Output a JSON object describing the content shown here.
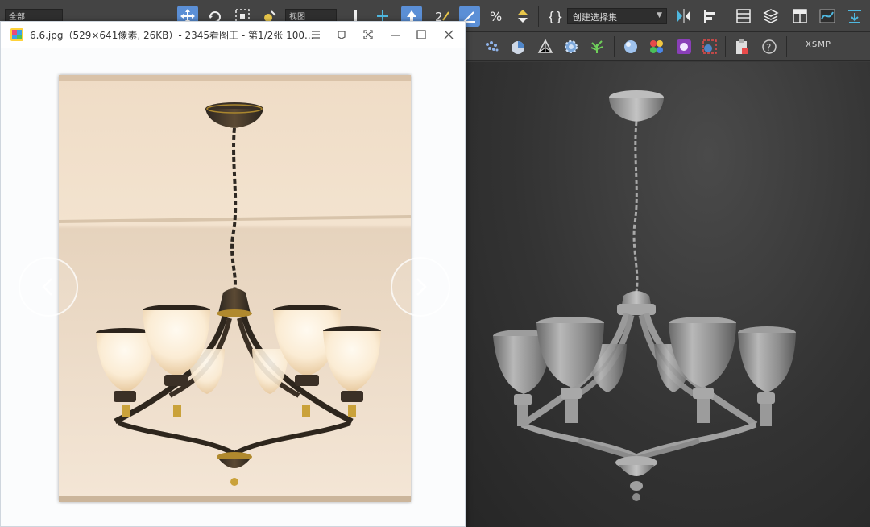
{
  "max": {
    "selection_filter": "全部",
    "view_dropdown": "视图",
    "named_selection": "创建选择集",
    "renderer_label": "XSMP",
    "colors": {
      "toolbar_bg": "#444444",
      "active_btn": "#5b8fd6",
      "viewport_bg": "#333333"
    }
  },
  "viewer": {
    "title": "6.6.jpg（529×641像素, 26KB）- 2345看图王 - 第1/2张 100...",
    "icons": [
      "menu-icon",
      "pin-icon",
      "fullscreen-icon",
      "minimize-icon",
      "maximize-icon",
      "close-icon",
      "prev-arrow-icon",
      "next-arrow-icon"
    ]
  }
}
